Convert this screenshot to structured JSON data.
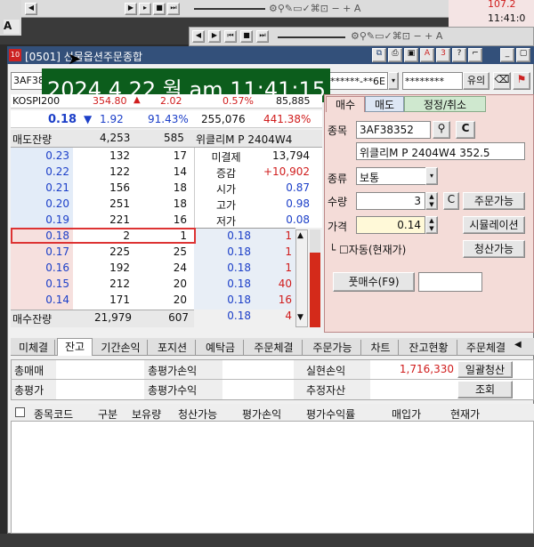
{
  "top": {
    "right_price": "107.2",
    "right_time": "11:41:0",
    "a_label": "A",
    "zoom_minus": "−",
    "zoom_plus": "+"
  },
  "window": {
    "title": "[0501] 선물옵션주문종합",
    "timestamp": "2024.4.22 월 am 11:41:15",
    "code": "3AF38",
    "account_masked": "******-**6E",
    "password_masked": "********",
    "confirm_label": "유의",
    "topbtn_3": "3",
    "topbtn_q": "?"
  },
  "quote": {
    "index_name": "KOSPI200",
    "index_value": "354.80",
    "index_change": "2.02",
    "index_rate": "0.57%",
    "index_volume": "85,885",
    "price": "0.18",
    "change": "1.92",
    "rate": "91.43%",
    "volume": "255,076",
    "volume_rate": "441.38%"
  },
  "book": {
    "ask_header": "매도잔량",
    "ask_total": "4,253",
    "ask_total_cnt": "585",
    "item_header": "위클리M P 2404W4",
    "bid_header": "매수잔량",
    "bid_total": "21,979",
    "bid_total_cnt": "607",
    "asks": [
      {
        "price": "0.23",
        "qty": "132",
        "cnt": "17"
      },
      {
        "price": "0.22",
        "qty": "122",
        "cnt": "14"
      },
      {
        "price": "0.21",
        "qty": "156",
        "cnt": "18"
      },
      {
        "price": "0.20",
        "qty": "251",
        "cnt": "18"
      },
      {
        "price": "0.19",
        "qty": "221",
        "cnt": "16"
      }
    ],
    "bids": [
      {
        "price": "0.18",
        "qty": "2",
        "cnt": "1"
      },
      {
        "price": "0.17",
        "qty": "225",
        "cnt": "25"
      },
      {
        "price": "0.16",
        "qty": "192",
        "cnt": "24"
      },
      {
        "price": "0.15",
        "qty": "212",
        "cnt": "20"
      },
      {
        "price": "0.14",
        "qty": "171",
        "cnt": "20"
      }
    ],
    "info": [
      {
        "label": "미결제",
        "value": "13,794"
      },
      {
        "label": "증감",
        "value": "+10,902"
      },
      {
        "label": "시가",
        "value": "0.87"
      },
      {
        "label": "고가",
        "value": "0.98"
      },
      {
        "label": "저가",
        "value": "0.08"
      }
    ],
    "ticks": [
      {
        "price": "0.18",
        "qty": "1"
      },
      {
        "price": "0.18",
        "qty": "1"
      },
      {
        "price": "0.18",
        "qty": "1"
      },
      {
        "price": "0.18",
        "qty": "40"
      },
      {
        "price": "0.18",
        "qty": "16"
      },
      {
        "price": "0.18",
        "qty": "4"
      }
    ]
  },
  "order": {
    "tabs": [
      "매수",
      "매도",
      "정정/취소"
    ],
    "item_label": "종목",
    "item_code": "3AF38352",
    "item_name": "위클리M P 2404W4 352.5",
    "type_label": "종류",
    "type_value": "보통",
    "qty_label": "수량",
    "qty_value": "3",
    "c_label": "C",
    "orderable_btn": "주문가능",
    "price_label": "가격",
    "price_value": "0.14",
    "simulation_btn": "시뮬레이션",
    "auto_label": "└ ☐자동(현재가)",
    "closable_btn": "청산가능",
    "submit_btn": "풋매수(F9)"
  },
  "bottom": {
    "tabs": [
      "미체결",
      "잔고",
      "기간손익",
      "포지션",
      "예탁금",
      "주문체결",
      "주문가능",
      "차트",
      "잔고현황",
      "주문체결"
    ],
    "row1": [
      "총매매",
      "총평가손익",
      "실현손익",
      "1,716,330",
      "일괄청산"
    ],
    "row2": [
      "총평가",
      "총평가수익",
      "추정자산",
      "조회"
    ],
    "headers": [
      "종목코드",
      "구분",
      "보유량",
      "청산가능",
      "평가손익",
      "평가수익률",
      "매입가",
      "현재가"
    ]
  }
}
